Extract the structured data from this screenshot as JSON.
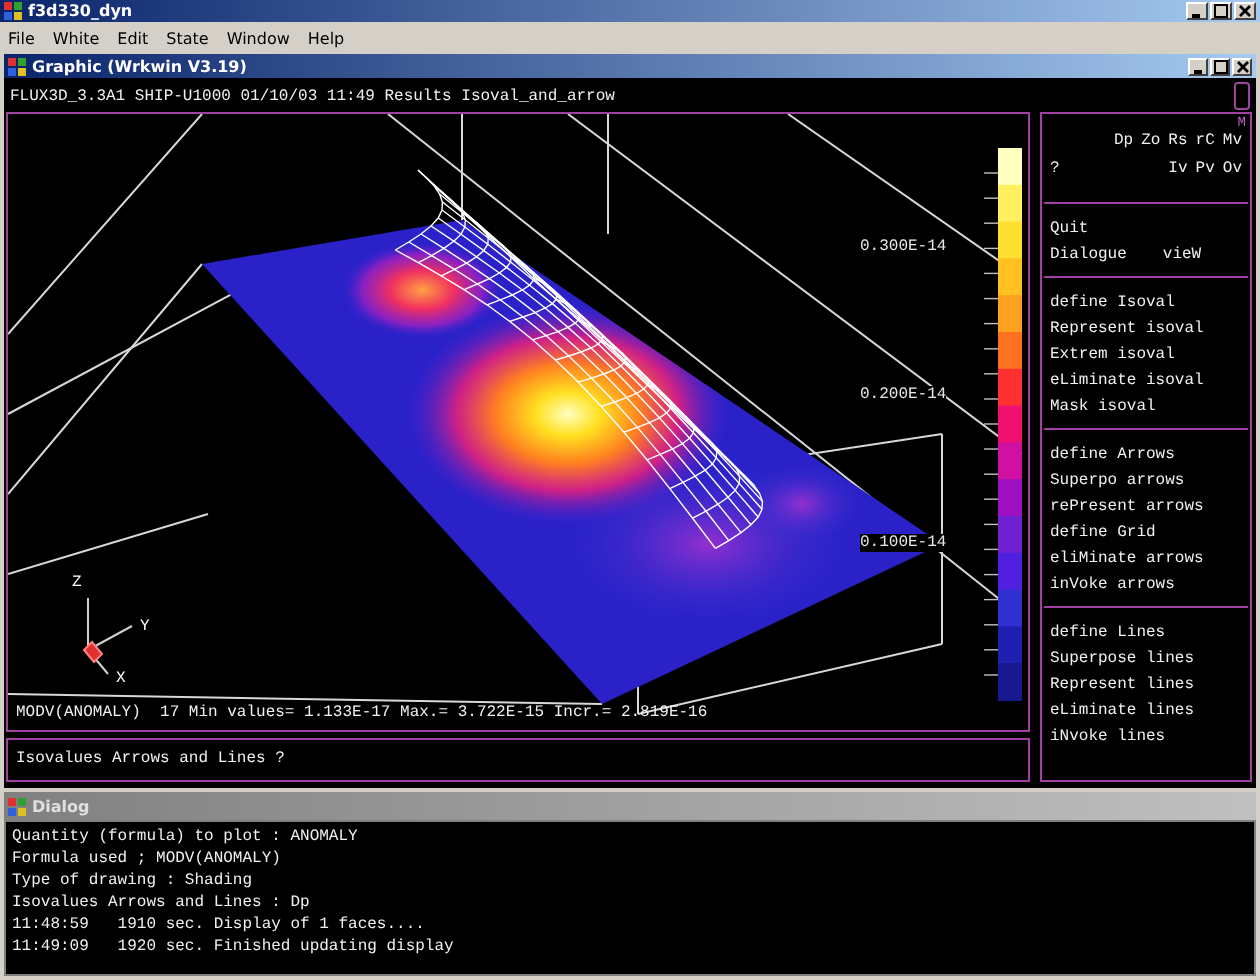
{
  "app": {
    "title": "f3d330_dyn",
    "menu": [
      "File",
      "White",
      "Edit",
      "State",
      "Window",
      "Help"
    ]
  },
  "graphic_window": {
    "title": "Graphic (Wrkwin V3.19)",
    "header": "FLUX3D_3.3A1 SHIP-U1000 01/10/03 11:49 Results Isoval_and_arrow",
    "plot": {
      "scale_labels": [
        "0.300E-14",
        "0.200E-14",
        "0.100E-14"
      ],
      "axes": [
        "Z",
        "Y",
        "X"
      ],
      "summary": "MODV(ANOMALY)  17 Min values= 1.133E-17 Max.= 3.722E-15 Incr.= 2.819E-16"
    },
    "prompt": "Isovalues Arrows and Lines ?",
    "command_panel": {
      "corner_mark": "M",
      "shortcuts_row_1": [
        "Dp",
        "Zo",
        "Rs",
        "rC",
        "Mv"
      ],
      "help": "?",
      "shortcuts_row_2": [
        "Iv",
        "Pv",
        "Ov"
      ],
      "groups": [
        [
          [
            "Quit"
          ],
          [
            "Dialogue",
            "vieW"
          ]
        ],
        [
          [
            "define Isoval"
          ],
          [
            "Represent isoval"
          ],
          [
            "Extrem isoval"
          ],
          [
            "eLiminate isoval"
          ],
          [
            "Mask isoval"
          ]
        ],
        [
          [
            "define Arrows"
          ],
          [
            "Superpo arrows"
          ],
          [
            "rePresent arrows"
          ],
          [
            "define Grid"
          ],
          [
            "eliMinate arrows"
          ],
          [
            "inVoke arrows"
          ]
        ],
        [
          [
            "define Lines"
          ],
          [
            "Superpose lines"
          ],
          [
            "Represent lines"
          ],
          [
            "eLiminate lines"
          ],
          [
            "iNvoke lines"
          ]
        ]
      ]
    }
  },
  "dialog": {
    "title": "Dialog",
    "lines": [
      "Quantity (formula) to plot : ANOMALY",
      "Formula used ; MODV(ANOMALY)",
      "Type of drawing : Shading",
      "Isovalues Arrows and Lines : Dp",
      "11:48:59   1910 sec. Display of 1 faces....",
      "11:49:09   1920 sec. Finished updating display"
    ]
  }
}
